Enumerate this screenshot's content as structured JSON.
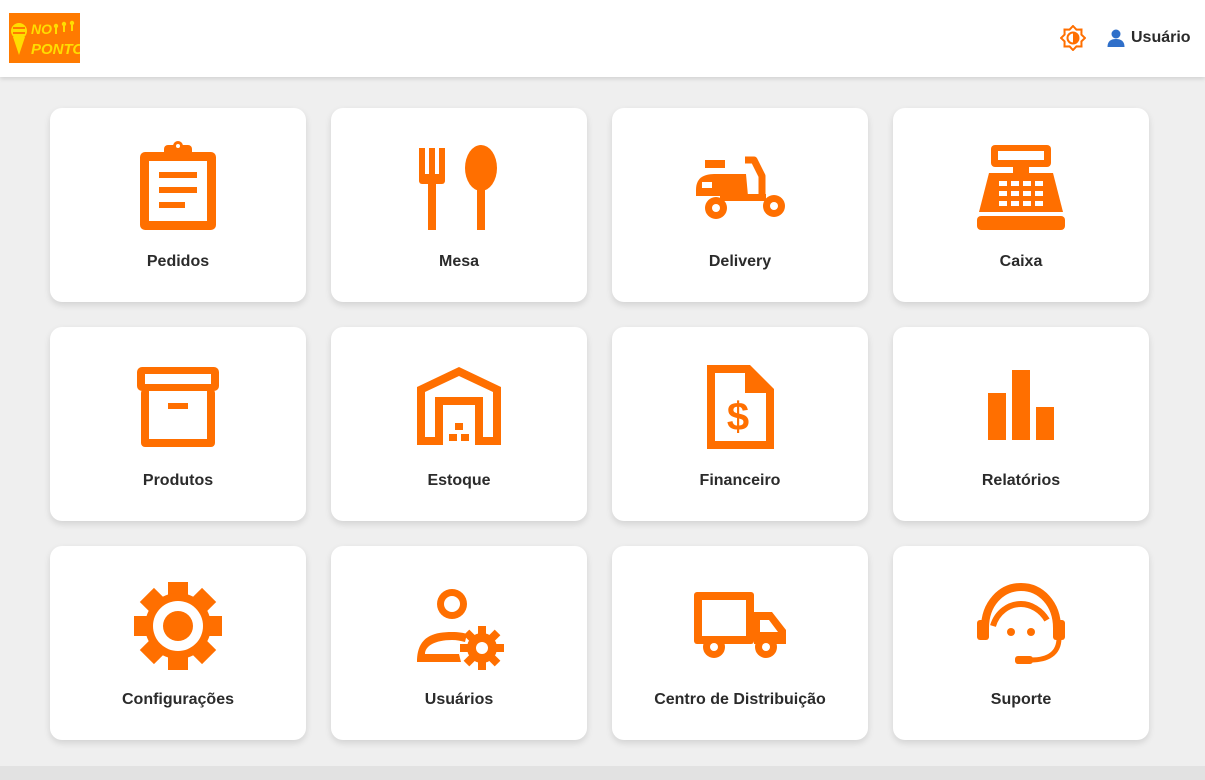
{
  "brand": {
    "logo_text_line1": "NO",
    "logo_text_line2": "PONTO",
    "logo_bg": "#ff7a00",
    "logo_fg": "#ffdd00"
  },
  "header": {
    "theme_toggle_icon": "brightness-icon",
    "user_icon": "person-icon",
    "user_label": "Usuário"
  },
  "colors": {
    "accent": "#ff6f00",
    "background": "#efefef",
    "card": "#ffffff",
    "text": "#2b2b2b",
    "user_icon": "#2f6fc9"
  },
  "menu": {
    "tiles": [
      {
        "label": "Pedidos",
        "icon": "clipboard-icon"
      },
      {
        "label": "Mesa",
        "icon": "fork-spoon-icon"
      },
      {
        "label": "Delivery",
        "icon": "scooter-icon"
      },
      {
        "label": "Caixa",
        "icon": "cash-register-icon"
      },
      {
        "label": "Produtos",
        "icon": "archive-box-icon"
      },
      {
        "label": "Estoque",
        "icon": "warehouse-icon"
      },
      {
        "label": "Financeiro",
        "icon": "invoice-dollar-icon"
      },
      {
        "label": "Relatórios",
        "icon": "bar-chart-icon"
      },
      {
        "label": "Configurações",
        "icon": "gear-icon"
      },
      {
        "label": "Usuários",
        "icon": "user-settings-icon"
      },
      {
        "label": "Centro de Distribuição",
        "icon": "truck-icon"
      },
      {
        "label": "Suporte",
        "icon": "headset-icon"
      }
    ]
  }
}
